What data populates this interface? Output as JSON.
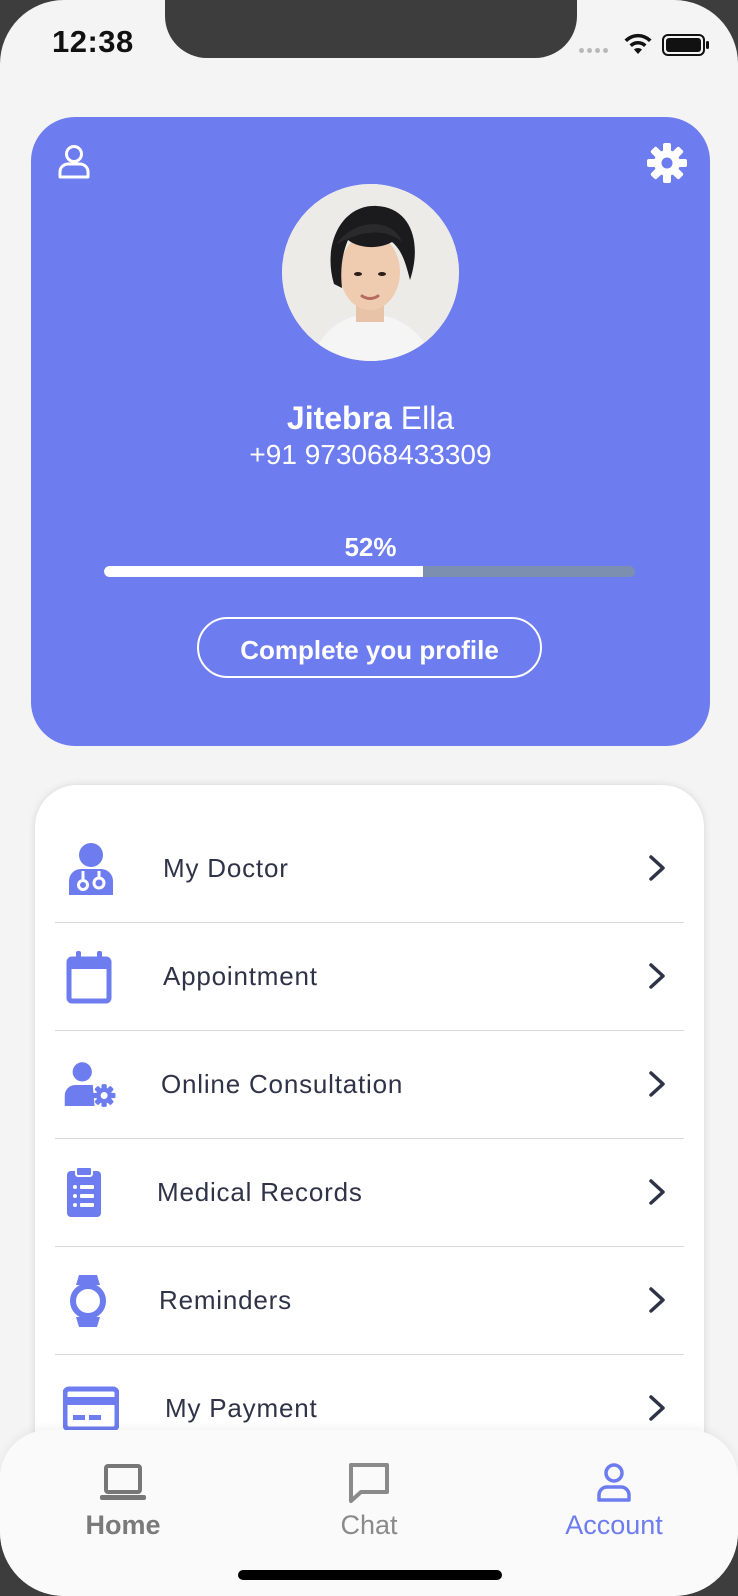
{
  "status_bar": {
    "time": "12:38"
  },
  "profile": {
    "first_name": "Jitebra",
    "last_name": "Ella",
    "phone": "+91 973068433309",
    "progress_label": "52%",
    "progress_value": 0.6,
    "complete_button": "Complete you profile"
  },
  "menu": {
    "items": [
      {
        "label": "My Doctor",
        "icon": "doctor-icon"
      },
      {
        "label": "Appointment",
        "icon": "calendar-icon"
      },
      {
        "label": "Online Consultation",
        "icon": "user-settings-icon"
      },
      {
        "label": "Medical Records",
        "icon": "clipboard-list-icon"
      },
      {
        "label": "Reminders",
        "icon": "watch-icon"
      },
      {
        "label": "My Payment",
        "icon": "credit-card-icon"
      }
    ]
  },
  "tabbar": {
    "home": "Home",
    "chat": "Chat",
    "account": "Account",
    "active": "account"
  },
  "colors": {
    "accent": "#6d7cef",
    "text_dark": "#2f3347",
    "inactive_tab": "#7a7a7a"
  }
}
